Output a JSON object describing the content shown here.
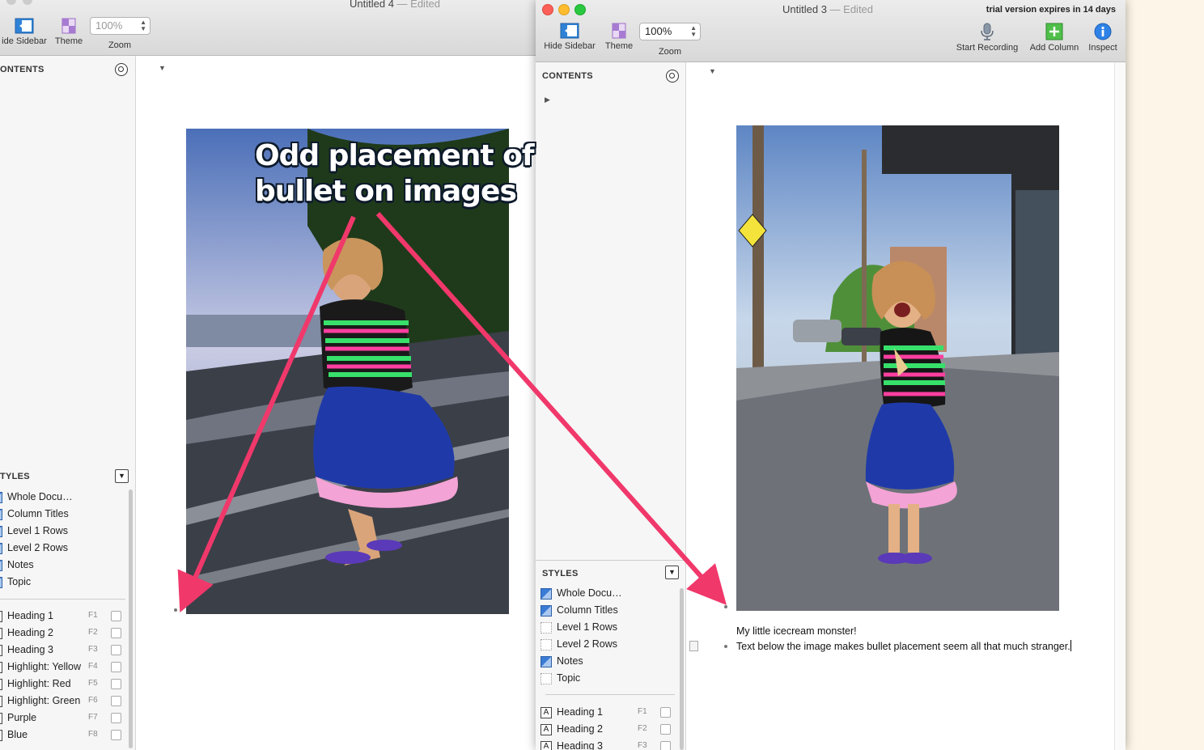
{
  "back_window": {
    "title": "Untitled 4",
    "title_status": "— Edited",
    "toolbar": {
      "hide_sidebar_label": "ide Sidebar",
      "theme_label": "Theme",
      "zoom_label": "Zoom",
      "zoom_value": "100%"
    },
    "sidebar": {
      "contents_header": "ONTENTS",
      "styles_header": "TYLES",
      "styles": [
        {
          "label": "Whole Docu…"
        },
        {
          "label": "Column Titles"
        },
        {
          "label": "Level 1 Rows"
        },
        {
          "label": "Level 2 Rows"
        },
        {
          "label": "Notes"
        },
        {
          "label": "Topic"
        }
      ],
      "named_styles": [
        {
          "label": "Heading 1",
          "key": "F1"
        },
        {
          "label": "Heading 2",
          "key": "F2"
        },
        {
          "label": "Heading 3",
          "key": "F3"
        },
        {
          "label": "Highlight: Yellow",
          "key": "F4"
        },
        {
          "label": "Highlight: Red",
          "key": "F5"
        },
        {
          "label": "Highlight: Green",
          "key": "F6"
        },
        {
          "label": "Purple",
          "key": "F7"
        },
        {
          "label": "Blue",
          "key": "F8"
        }
      ]
    }
  },
  "annotation": {
    "line1": "Odd placement of",
    "line2": "bullet on images",
    "color": "#f0386b"
  },
  "front_window": {
    "title": "Untitled 3",
    "title_status": "— Edited",
    "trial_notice": "trial version expires in 14 days",
    "toolbar": {
      "hide_sidebar_label": "Hide Sidebar",
      "theme_label": "Theme",
      "zoom_label": "Zoom",
      "zoom_value": "100%",
      "start_recording_label": "Start Recording",
      "add_column_label": "Add Column",
      "inspect_label": "Inspect"
    },
    "sidebar": {
      "contents_header": "CONTENTS",
      "styles_header": "STYLES",
      "styles": [
        {
          "label": "Whole Docu…",
          "swatch": "blue"
        },
        {
          "label": "Column Titles",
          "swatch": "blue"
        },
        {
          "label": "Level 1 Rows",
          "swatch": "empty"
        },
        {
          "label": "Level 2 Rows",
          "swatch": "empty"
        },
        {
          "label": "Notes",
          "swatch": "blue"
        },
        {
          "label": "Topic",
          "swatch": "empty"
        }
      ],
      "named_styles": [
        {
          "label": "Heading 1",
          "key": "F1"
        },
        {
          "label": "Heading 2",
          "key": "F2"
        },
        {
          "label": "Heading 3",
          "key": "F3"
        }
      ]
    },
    "document": {
      "caption": "My little icecream monster!",
      "row_text": "Text below the image makes bullet placement seem all that much stranger."
    }
  }
}
